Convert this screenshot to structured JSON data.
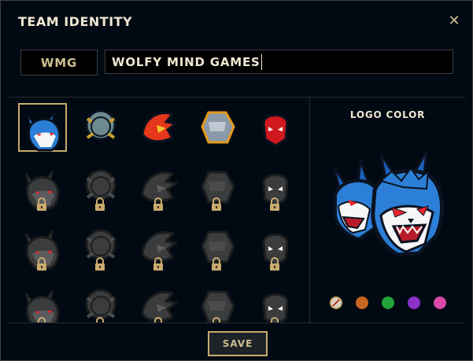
{
  "dialog": {
    "title": "TEAM IDENTITY",
    "close_label": "✕"
  },
  "team": {
    "tag": "WMG",
    "name": "WOLFY MIND GAMES"
  },
  "logos": [
    {
      "icon": "wolf-logo-icon",
      "locked": false,
      "selected": true,
      "color": "#2b7fd6"
    },
    {
      "icon": "walrus-logo-icon",
      "locked": false,
      "selected": false,
      "color": "#6d8a8e"
    },
    {
      "icon": "phoenix-logo-icon",
      "locked": false,
      "selected": false,
      "color": "#e5371a"
    },
    {
      "icon": "golem-logo-icon",
      "locked": false,
      "selected": false,
      "color": "#8a9aa8"
    },
    {
      "icon": "demon-logo-icon",
      "locked": false,
      "selected": false,
      "color": "#d0191e"
    },
    {
      "icon": "bear-logo-icon",
      "locked": true
    },
    {
      "icon": "dino-logo-icon",
      "locked": true
    },
    {
      "icon": "bomb-logo-icon",
      "locked": true
    },
    {
      "icon": "spider-logo-icon",
      "locked": true
    },
    {
      "icon": "panther-logo-icon",
      "locked": true
    },
    {
      "icon": "serpent-logo-icon",
      "locked": true
    },
    {
      "icon": "planet-logo-icon",
      "locked": true
    },
    {
      "icon": "crest-logo-icon",
      "locked": true
    },
    {
      "icon": "beast-logo-icon",
      "locked": true
    },
    {
      "icon": "skull-logo-icon",
      "locked": true
    },
    {
      "icon": "rock-logo-icon",
      "locked": true
    },
    {
      "icon": "knight-logo-icon",
      "locked": true
    },
    {
      "icon": "raptor-logo-icon",
      "locked": true
    },
    {
      "icon": "ogre-logo-icon",
      "locked": true
    },
    {
      "icon": "dragon-logo-icon",
      "locked": true
    }
  ],
  "logo_color": {
    "title": "LOGO COLOR",
    "preview_icon": "wolf-logo-icon",
    "swatches": [
      {
        "name": "default",
        "color": "#d8d4c8",
        "selected": true
      },
      {
        "name": "orange",
        "color": "#c8651e"
      },
      {
        "name": "green",
        "color": "#23a33a"
      },
      {
        "name": "purple",
        "color": "#8c32c8"
      },
      {
        "name": "pink",
        "color": "#d84aa8"
      }
    ]
  },
  "save_label": "SAVE",
  "colors": {
    "background": "#010a13",
    "gold": "#c8aa6e",
    "text": "#f0e6d2",
    "wolf_blue": "#2b7fd6"
  }
}
